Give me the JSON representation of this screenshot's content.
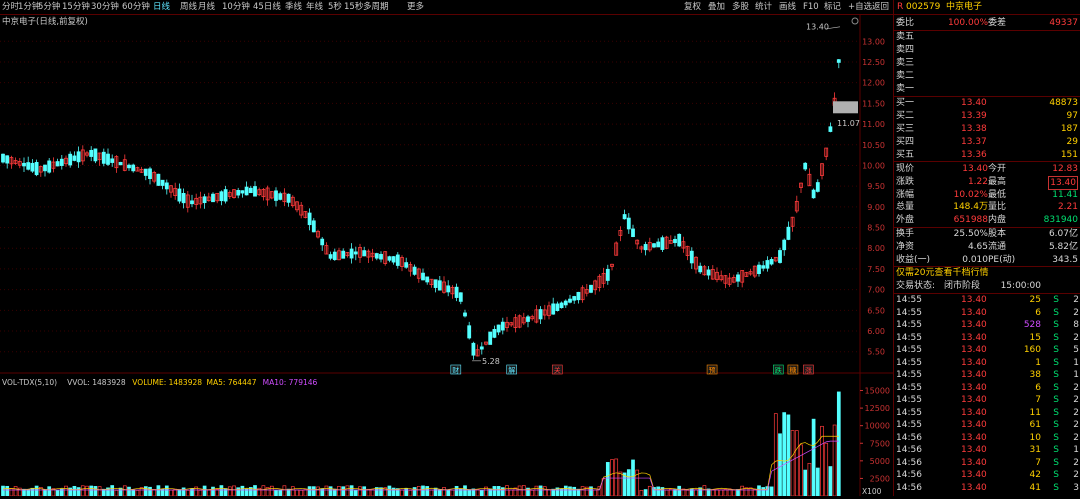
{
  "toolbar": {
    "tabs": [
      "分时",
      "1分钟",
      "5分钟",
      "15分钟",
      "30分钟",
      "60分钟",
      "日线",
      "周线",
      "月线",
      "10分钟",
      "45日线",
      "季线",
      "年线",
      "5秒",
      "15秒",
      "多周期",
      "更多"
    ],
    "active_tab": "日线",
    "right_buttons": [
      "复权",
      "叠加",
      "多股",
      "统计",
      "画线",
      "F10",
      "标记",
      "+自选",
      "返回"
    ]
  },
  "chart": {
    "title": "中京电子(日线,前复权)",
    "high_label": "13.40",
    "low_label": "5.28",
    "current_label": "11.07",
    "price_ticks": [
      "13.00",
      "12.50",
      "12.00",
      "11.50",
      "11.00",
      "10.50",
      "10.00",
      "9.50",
      "9.00",
      "8.50",
      "8.00",
      "7.50",
      "7.00",
      "6.50",
      "6.00",
      "5.50"
    ],
    "markers": [
      {
        "text": "财",
        "color": "#5ee6ff",
        "pos": 0.53
      },
      {
        "text": "解",
        "color": "#5ee6ff",
        "pos": 0.595
      },
      {
        "text": "关",
        "color": "#ff3b3b",
        "pos": 0.648
      },
      {
        "text": "预",
        "color": "#ff8800",
        "pos": 0.828
      },
      {
        "text": "跌",
        "color": "#00e070",
        "pos": 0.905
      },
      {
        "text": "糖",
        "color": "#ff8800",
        "pos": 0.922
      },
      {
        "text": "涨",
        "color": "#ff3b3b",
        "pos": 0.94
      }
    ],
    "volume": {
      "indicator": "VOL-TDX(5,10)",
      "vvol": "VVOL: 1483928",
      "volume": "VOLUME: 1483928",
      "ma5": "MA5: 764447",
      "ma10": "MA10: 779146",
      "ticks": [
        "15000",
        "12500",
        "10000",
        "7500",
        "5000",
        "2500"
      ],
      "unit": "X100"
    }
  },
  "panel": {
    "code": "002579",
    "name": "中京电子",
    "webi": {
      "label": "委比",
      "value": "100.00%",
      "label2": "委差",
      "value2": "49337"
    },
    "asks": [
      {
        "label": "卖五",
        "price": "",
        "vol": ""
      },
      {
        "label": "卖四",
        "price": "",
        "vol": ""
      },
      {
        "label": "卖三",
        "price": "",
        "vol": ""
      },
      {
        "label": "卖二",
        "price": "",
        "vol": ""
      },
      {
        "label": "卖一",
        "price": "",
        "vol": ""
      }
    ],
    "bids": [
      {
        "label": "买一",
        "price": "13.40",
        "vol": "48873"
      },
      {
        "label": "买二",
        "price": "13.39",
        "vol": "97"
      },
      {
        "label": "买三",
        "price": "13.38",
        "vol": "187"
      },
      {
        "label": "买四",
        "price": "13.37",
        "vol": "29"
      },
      {
        "label": "买五",
        "price": "13.36",
        "vol": "151"
      }
    ],
    "quote": [
      {
        "l1": "现价",
        "v1": "13.40",
        "l2": "今开",
        "v2": "12.83",
        "c1": "r",
        "c2": "r"
      },
      {
        "l1": "涨跌",
        "v1": "1.22",
        "l2": "最高",
        "v2": "13.40",
        "c1": "r",
        "c2": "r"
      },
      {
        "l1": "涨幅",
        "v1": "10.02%",
        "l2": "最低",
        "v2": "11.41",
        "c1": "r",
        "c2": "g"
      },
      {
        "l1": "总量",
        "v1": "148.4万",
        "l2": "量比",
        "v2": "2.21",
        "c1": "y",
        "c2": "r"
      },
      {
        "l1": "外盘",
        "v1": "651988",
        "l2": "内盘",
        "v2": "831940",
        "c1": "r",
        "c2": "g"
      }
    ],
    "fundamentals": [
      {
        "l1": "换手",
        "v1": "25.50%",
        "l2": "股本",
        "v2": "6.07亿"
      },
      {
        "l1": "净资",
        "v1": "4.65",
        "l2": "流通",
        "v2": "5.82亿"
      },
      {
        "l1": "收益(一)",
        "v1": "0.010",
        "l2": "PE(动)",
        "v2": "343.5"
      }
    ],
    "promo": "仅需20元查看千档行情",
    "status_label": "交易状态:",
    "status_value": "闭市阶段",
    "status_time": "15:00:00",
    "ticks": [
      {
        "t": "14:55",
        "p": "13.40",
        "v": "25",
        "s": "S",
        "n": "2",
        "vc": "y"
      },
      {
        "t": "14:55",
        "p": "13.40",
        "v": "6",
        "s": "S",
        "n": "2",
        "vc": "y"
      },
      {
        "t": "14:55",
        "p": "13.40",
        "v": "528",
        "s": "S",
        "n": "8",
        "vc": "m"
      },
      {
        "t": "14:55",
        "p": "13.40",
        "v": "15",
        "s": "S",
        "n": "2",
        "vc": "y"
      },
      {
        "t": "14:55",
        "p": "13.40",
        "v": "160",
        "s": "S",
        "n": "5",
        "vc": "y"
      },
      {
        "t": "14:55",
        "p": "13.40",
        "v": "1",
        "s": "S",
        "n": "1",
        "vc": "y"
      },
      {
        "t": "14:55",
        "p": "13.40",
        "v": "38",
        "s": "S",
        "n": "1",
        "vc": "y"
      },
      {
        "t": "14:55",
        "p": "13.40",
        "v": "6",
        "s": "S",
        "n": "2",
        "vc": "y"
      },
      {
        "t": "14:55",
        "p": "13.40",
        "v": "7",
        "s": "S",
        "n": "2",
        "vc": "y"
      },
      {
        "t": "14:55",
        "p": "13.40",
        "v": "11",
        "s": "S",
        "n": "2",
        "vc": "y"
      },
      {
        "t": "14:55",
        "p": "13.40",
        "v": "61",
        "s": "S",
        "n": "2",
        "vc": "y"
      },
      {
        "t": "14:56",
        "p": "13.40",
        "v": "10",
        "s": "S",
        "n": "2",
        "vc": "y"
      },
      {
        "t": "14:56",
        "p": "13.40",
        "v": "31",
        "s": "S",
        "n": "1",
        "vc": "y"
      },
      {
        "t": "14:56",
        "p": "13.40",
        "v": "7",
        "s": "S",
        "n": "2",
        "vc": "y"
      },
      {
        "t": "14:56",
        "p": "13.40",
        "v": "42",
        "s": "S",
        "n": "2",
        "vc": "y"
      },
      {
        "t": "14:56",
        "p": "13.40",
        "v": "41",
        "s": "S",
        "n": "3",
        "vc": "y"
      }
    ]
  }
}
